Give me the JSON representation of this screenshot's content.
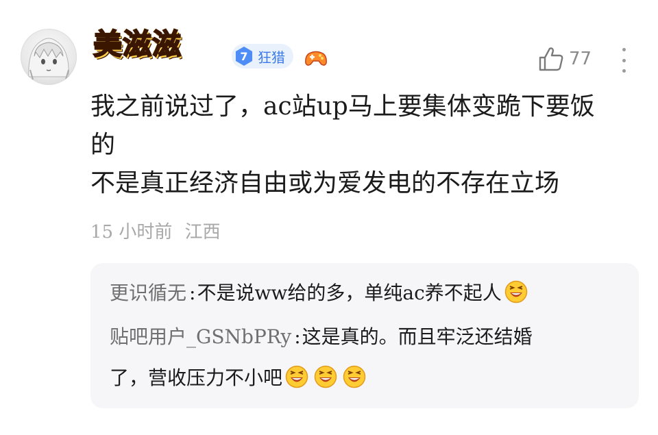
{
  "comment": {
    "username": "美滋滋",
    "level": {
      "number": "7",
      "title": "狂猎"
    },
    "badge_icon": "game-controller-icon",
    "likes": "77",
    "lines": [
      "我之前说过了，ac站up马上要集体变跪下要饭",
      "的",
      "不是真正经济自由或为爱发电的不存在立场"
    ],
    "time": "15 小时前",
    "location": "江西"
  },
  "replies": [
    {
      "author": "更识循无",
      "colon": ":",
      "text": "不是说ww给的多，单纯ac养不起人",
      "emoji_count": 1
    },
    {
      "author": "贴吧用户_GSNbPRy",
      "colon": ":",
      "text_line1": "这是真的。而且牢泛还结婚",
      "text_line2": "了，营收压力不小吧",
      "emoji_count": 3
    }
  ],
  "colors": {
    "username_fill": "#ff3a1a",
    "level_badge": "#4d8df5",
    "level_text": "#3b7ae8",
    "meta_text": "#a8a8a8",
    "reply_bg": "#f6f6f8"
  }
}
